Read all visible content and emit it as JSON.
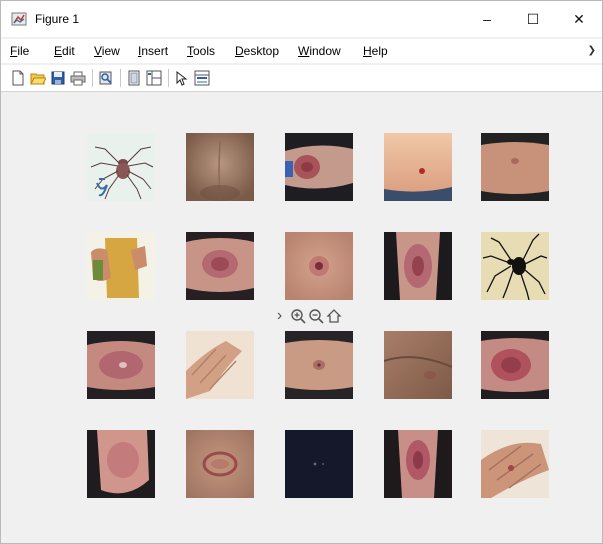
{
  "window": {
    "title": "Figure 1",
    "controls": {
      "minimize": "–",
      "maximize": "☐",
      "close": "✕"
    }
  },
  "menu": {
    "items": [
      {
        "first": "F",
        "rest": "ile"
      },
      {
        "first": "E",
        "rest": "dit"
      },
      {
        "first": "V",
        "rest": "iew"
      },
      {
        "first": "I",
        "rest": "nsert"
      },
      {
        "first": "T",
        "rest": "ools"
      },
      {
        "first": "D",
        "rest": "esktop"
      },
      {
        "first": "W",
        "rest": "indow"
      },
      {
        "first": "H",
        "rest": "elp"
      }
    ],
    "overflow": "❯"
  },
  "toolbar": {
    "icons": [
      "new-figure-icon",
      "open-file-icon",
      "save-icon",
      "print-icon",
      "print-preview-icon",
      "hide-plot-tools-icon",
      "show-plot-tools-icon",
      "edit-plot-icon",
      "open-property-inspector-icon"
    ]
  },
  "axes_toolbar": {
    "icons": [
      "more-options-icon",
      "zoom-in-icon",
      "zoom-out-icon",
      "restore-view-icon"
    ],
    "more_glyph": "›"
  },
  "grid": {
    "rows": 4,
    "cols": 5,
    "images": [
      "spider-illustration",
      "skin-back",
      "arm-bite-mark",
      "skin-red-dot",
      "arm-skin",
      "hand-with-medication",
      "arm-red-patch",
      "skin-bite-center",
      "limb-red-lesion",
      "black-widow-spider",
      "forearm-rash",
      "hand-fingers",
      "arm-bite-small",
      "wrist-skin",
      "forearm-redness",
      "leg-bruise",
      "ring-lesion",
      "dark-spot-image",
      "leg-lesion",
      "hand-bite"
    ]
  }
}
